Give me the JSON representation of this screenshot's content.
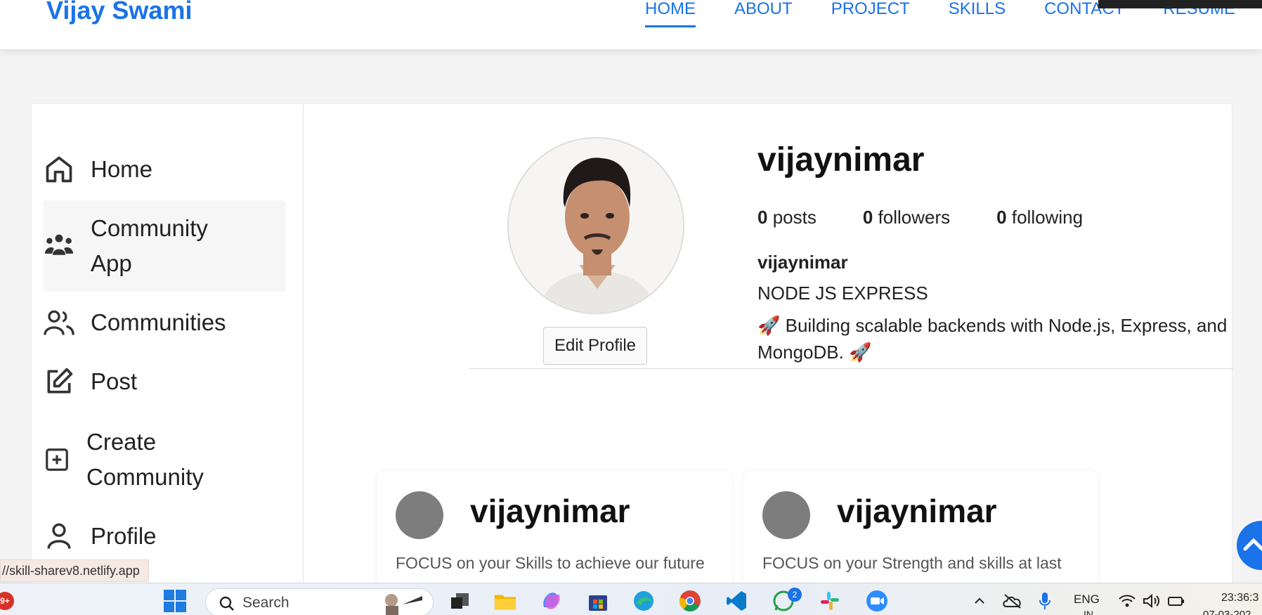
{
  "nav": {
    "brand": "Vijay Swami",
    "links": [
      "HOME",
      "ABOUT",
      "PROJECT",
      "SKILLS",
      "CONTACT",
      "RESUME"
    ]
  },
  "sidebar": {
    "items": [
      {
        "label": "Home",
        "icon": "home-icon"
      },
      {
        "label": "Community App",
        "icon": "users-group-icon"
      },
      {
        "label": "Communities",
        "icon": "people-icon"
      },
      {
        "label": "Post",
        "icon": "edit-icon"
      },
      {
        "label": "Create Community",
        "icon": "plus-square-icon"
      },
      {
        "label": "Profile",
        "icon": "user-icon"
      }
    ]
  },
  "profile": {
    "username": "vijaynimar",
    "posts_count": "0",
    "posts_label": "posts",
    "followers_count": "0",
    "followers_label": "followers",
    "following_count": "0",
    "following_label": "following",
    "bio_name": "vijaynimar",
    "bio_title": "NODE JS EXPRESS",
    "bio_text": "🚀 Building scalable backends with Node.js, Express, and MongoDB. 🚀",
    "edit_label": "Edit Profile"
  },
  "posts": [
    {
      "user": "vijaynimar",
      "text": "FOCUS on your Skills to achieve our future"
    },
    {
      "user": "vijaynimar",
      "text": "FOCUS on your Strength and skills at last"
    }
  ],
  "status_url": "//skill-sharev8.netlify.app",
  "taskbar": {
    "badge": "9+",
    "search_placeholder": "Search",
    "whatsapp_count": "2",
    "lang": "ENG",
    "lang_region": "IN",
    "time": "23:36:3",
    "date": "07-03-202"
  },
  "colors": {
    "accent": "#1a73e8",
    "post_avatar": "#7d7d7d"
  }
}
